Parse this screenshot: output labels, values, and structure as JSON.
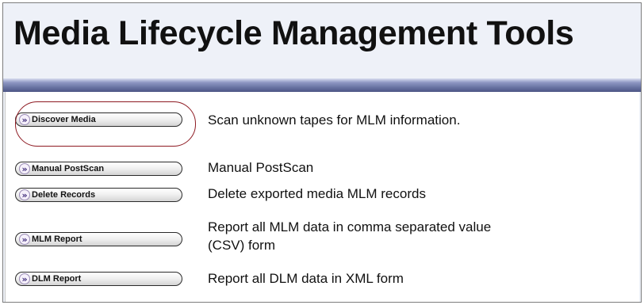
{
  "header": {
    "title": "Media Lifecycle Management Tools"
  },
  "actions": [
    {
      "button_label": "Discover Media",
      "description": "Scan unknown tapes for MLM information.",
      "highlighted": true
    },
    {
      "button_label": "Manual PostScan",
      "description": "Manual PostScan"
    },
    {
      "button_label": "Delete Records",
      "description": "Delete exported media MLM records"
    },
    {
      "button_label": "MLM Report",
      "description_line1": "Report all MLM data in comma separated value",
      "description_line2": "(CSV) form"
    },
    {
      "button_label": "DLM Report",
      "description": "Report all DLM data in XML form"
    }
  ],
  "icons": {
    "button_chevron": "double-chevron-right-icon"
  },
  "colors": {
    "title_bar": "#66709f",
    "highlight_ring": "#8e1a22",
    "chevron": "#3d2a79",
    "frame_background": "#eef1f8"
  }
}
